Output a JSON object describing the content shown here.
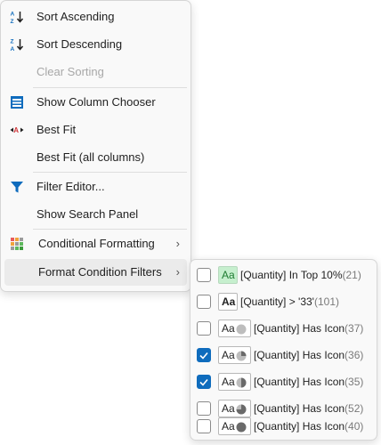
{
  "menu": {
    "sort_ascending": "Sort Ascending",
    "sort_descending": "Sort Descending",
    "clear_sorting": "Clear Sorting",
    "show_column_chooser": "Show Column Chooser",
    "best_fit": "Best Fit",
    "best_fit_all": "Best Fit (all columns)",
    "filter_editor": "Filter Editor...",
    "show_search_panel": "Show Search Panel",
    "conditional_formatting": "Conditional Formatting",
    "format_condition_filters": "Format Condition Filters",
    "submenu_chevron": "›"
  },
  "submenu": {
    "items": [
      {
        "preview": "Aa",
        "label": "[Quantity] In Top 10%",
        "count": "(21)",
        "checked": false
      },
      {
        "preview": "Aa",
        "label": "[Quantity] > '33'",
        "count": "(101)",
        "checked": false
      },
      {
        "preview": "Aa",
        "label": "[Quantity] Has Icon",
        "count": "(37)",
        "checked": false,
        "icon_fill": 0
      },
      {
        "preview": "Aa",
        "label": "[Quantity] Has Icon",
        "count": "(36)",
        "checked": true,
        "icon_fill": 0.25
      },
      {
        "preview": "Aa",
        "label": "[Quantity] Has Icon",
        "count": "(35)",
        "checked": true,
        "icon_fill": 0.5
      },
      {
        "preview": "Aa",
        "label": "[Quantity] Has Icon",
        "count": "(52)",
        "checked": false,
        "icon_fill": 0.75
      },
      {
        "preview": "Aa",
        "label": "[Quantity] Has Icon",
        "count": "(40)",
        "checked": false,
        "icon_fill": 1
      }
    ]
  },
  "colors": {
    "accent": "#0f6cbd",
    "top10_bg": "#c6efce",
    "top10_text": "#1e7b31"
  }
}
